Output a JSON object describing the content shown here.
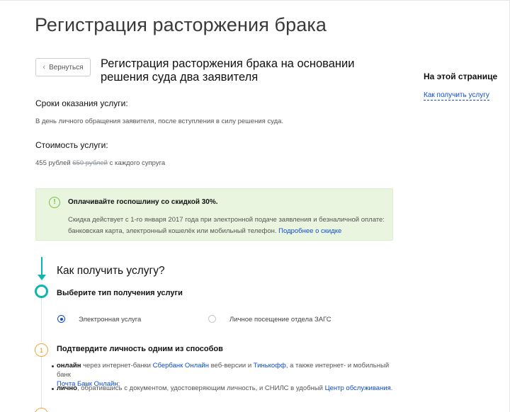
{
  "page": {
    "title": "Регистрация расторжения брака"
  },
  "nav": {
    "back_label": "Вернуться"
  },
  "service": {
    "title": "Регистрация расторжения брака на основании решения суда два заявителя"
  },
  "aside": {
    "heading": "На этой странице",
    "link": "Как получить услугу"
  },
  "terms": {
    "heading": "Сроки оказания услуги:",
    "text": "В день личного обращения заявителя, после вступления в силу решения суда."
  },
  "cost": {
    "heading": "Стоимость услуги:",
    "price": "455 рублей",
    "old_price": "650 рублей",
    "suffix": "с каждого супруга"
  },
  "notice": {
    "icon": "exclamation-circle-icon",
    "title": "Оплачивайте госпошлину со скидкой 30%.",
    "text": "Скидка действует с 1-го января 2017 года при электронной подаче заявления и безналичной оплате: банковская карта, электронный кошелёк или мобильный телефон.",
    "link": "Подробнее о скидке",
    "colors": {
      "background": "#e9f5df",
      "icon": "#7bbf3a"
    }
  },
  "how": {
    "heading": "Как получить услугу?",
    "step1": {
      "heading": "Выберите тип получения услуги",
      "options": [
        {
          "label": "Электронная услуга",
          "selected": true
        },
        {
          "label": "Личное посещение отдела ЗАГС",
          "selected": false
        }
      ]
    },
    "step2": {
      "number": "1",
      "heading": "Подтвердите личность одним из способов",
      "online": {
        "bold": "онлайн",
        "text1": "через интернет-банки",
        "link1": "Сбербанк Онлайн",
        "text2": "веб-версии и",
        "link2": "Тинькофф",
        "text3": ", а также интернет- и мобильный банк",
        "link3": "Почта Банк Онлайн",
        "text4": ";"
      },
      "personal": {
        "bold": "лично",
        "text1": ", обратившись с документом, удостоверяющим личность, и СНИЛС в удобный",
        "link": "Центр обслуживания",
        "text2": "."
      }
    }
  },
  "colors": {
    "accent": "#0fb4b4",
    "link": "#0d4cd3",
    "step_warning": "#f0a436"
  }
}
